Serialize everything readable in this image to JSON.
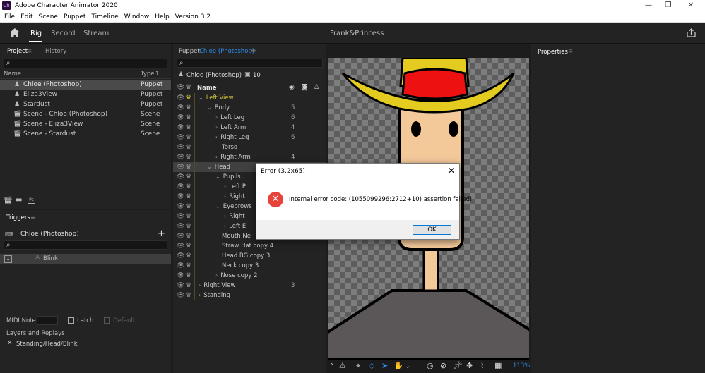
{
  "app": {
    "title": "Adobe Character Animator 2020",
    "icon_text": "Ch"
  },
  "window_controls": [
    "—",
    "❐",
    "✕"
  ],
  "menu": [
    "File",
    "Edit",
    "Scene",
    "Puppet",
    "Timeline",
    "Window",
    "Help",
    "Version 3.2"
  ],
  "header": {
    "tabs": [
      "Rig",
      "Record",
      "Stream"
    ],
    "active_tab": "Rig",
    "document_title": "Frank&Princess"
  },
  "project_panel": {
    "tabs": [
      "Project",
      "History"
    ],
    "columns": [
      "Name",
      "Type"
    ],
    "items": [
      {
        "name": "Chloe (Photoshop)",
        "type": "Puppet",
        "icon": "puppet-icon",
        "selected": true
      },
      {
        "name": "Eliza3View",
        "type": "Puppet",
        "icon": "puppet-icon"
      },
      {
        "name": "Stardust",
        "type": "Puppet",
        "icon": "puppet-icon"
      },
      {
        "name": "Scene - Chloe (Photoshop)",
        "type": "Scene",
        "icon": "scene-icon"
      },
      {
        "name": "Scene - Eliza3View",
        "type": "Scene",
        "icon": "scene-icon"
      },
      {
        "name": "Scene - Stardust",
        "type": "Scene",
        "icon": "scene-icon"
      }
    ],
    "footer_badge": "Ps"
  },
  "triggers_panel": {
    "title": "Triggers",
    "puppet_name": "Chloe (Photoshop)",
    "trigger_key": "1",
    "trigger_name": "Blink",
    "midi_note_label": "MIDI Note",
    "latch_label": "Latch",
    "default_label": "Default",
    "layers_title": "Layers and Replays",
    "layer_path": "Standing/Head/Blink"
  },
  "puppet_panel": {
    "title_prefix": "Puppet:",
    "title_name": "Chloe (Photoshop)",
    "puppet_name": "Chloe (Photoshop)",
    "handle_count": "10",
    "column_name": "Name",
    "layers": [
      {
        "name": "Left View",
        "depth": 0,
        "chevron": "⌄",
        "num": "",
        "highlight": true
      },
      {
        "name": "Body",
        "depth": 1,
        "chevron": "⌄",
        "num": "5"
      },
      {
        "name": "Left Leg",
        "depth": 2,
        "chevron": "›",
        "num": "6"
      },
      {
        "name": "Left Arm",
        "depth": 2,
        "chevron": "›",
        "num": "4"
      },
      {
        "name": "Right Leg",
        "depth": 2,
        "chevron": "›",
        "num": "6"
      },
      {
        "name": "Torso",
        "depth": 2,
        "chevron": "",
        "num": ""
      },
      {
        "name": "Right Arm",
        "depth": 2,
        "chevron": "›",
        "num": "4"
      },
      {
        "name": "Head",
        "depth": 1,
        "chevron": "⌄",
        "num": "",
        "selected": true
      },
      {
        "name": "Pupils",
        "depth": 2,
        "chevron": "⌄",
        "num": ""
      },
      {
        "name": "Left P",
        "depth": 3,
        "chevron": "›",
        "num": ""
      },
      {
        "name": "Right",
        "depth": 3,
        "chevron": "›",
        "num": ""
      },
      {
        "name": "Eyebrows",
        "depth": 2,
        "chevron": "⌄",
        "num": ""
      },
      {
        "name": "Right",
        "depth": 3,
        "chevron": "›",
        "num": ""
      },
      {
        "name": "Left E",
        "depth": 3,
        "chevron": "›",
        "num": ""
      },
      {
        "name": "Mouth Ne",
        "depth": 2,
        "chevron": "",
        "num": ""
      },
      {
        "name": "Straw Hat copy 4",
        "depth": 2,
        "chevron": "",
        "num": ""
      },
      {
        "name": "Head BG  copy 3",
        "depth": 2,
        "chevron": "",
        "num": ""
      },
      {
        "name": "Neck copy 3",
        "depth": 2,
        "chevron": "",
        "num": ""
      },
      {
        "name": "Nose copy 2",
        "depth": 2,
        "chevron": "›",
        "num": ""
      },
      {
        "name": "Right View",
        "depth": 0,
        "chevron": "›",
        "num": "3"
      },
      {
        "name": "Standing",
        "depth": 0,
        "chevron": "›",
        "num": ""
      }
    ]
  },
  "properties_panel": {
    "title": "Properties"
  },
  "canvas_toolbar": {
    "zoom": "113%"
  },
  "error_dialog": {
    "title": "Error (3.2x65)",
    "message": "Internal error code: (1055099296:2712+10) assertion failed!",
    "ok_label": "OK"
  },
  "colors": {
    "accent_blue": "#2d8ceb",
    "highlight_yellow": "#d4c23b",
    "error_red": "#e8423a",
    "panel_bg": "#232323"
  }
}
